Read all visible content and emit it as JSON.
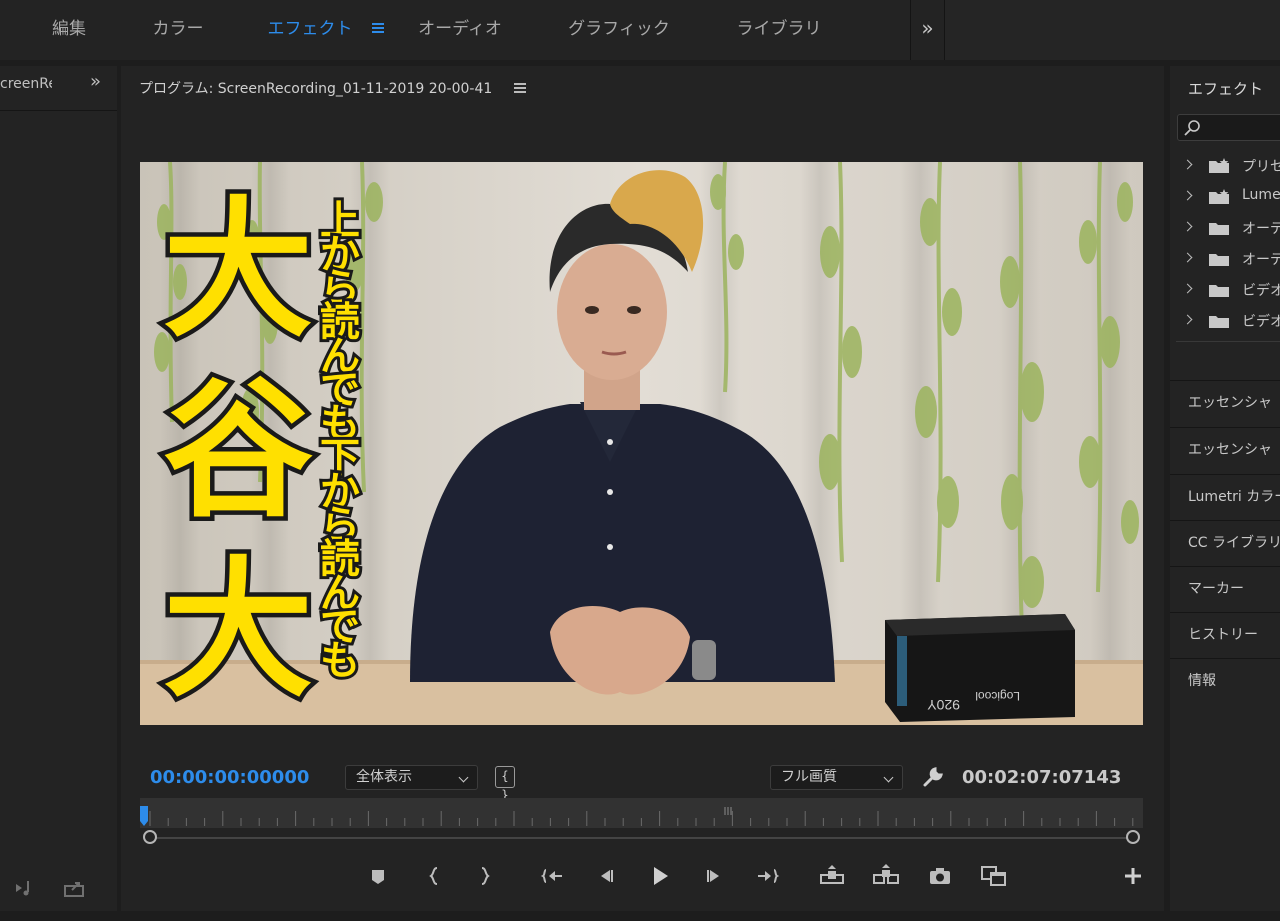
{
  "workspace_tabs": [
    {
      "label": "編集"
    },
    {
      "label": "カラー"
    },
    {
      "label": "エフェクト"
    },
    {
      "label": "オーディオ"
    },
    {
      "label": "グラフィック"
    },
    {
      "label": "ライブラリ"
    }
  ],
  "workspace_active": "エフェクト",
  "left_panel": {
    "tab_label": "creenRec"
  },
  "program_monitor": {
    "title": "プログラム: ScreenRecording_01-11-2019 20-00-41",
    "video_overlay": {
      "big_text": [
        "大",
        "谷",
        "大"
      ],
      "sub_text": "上から読んでも下から読んでも",
      "box_brand": "Logicool",
      "box_model": "920Y"
    },
    "current_timecode": "00:00:00:00000",
    "fit_dropdown": "全体表示",
    "quality_dropdown": "フル画質",
    "duration_timecode": "00:02:07:07143"
  },
  "effects_panel": {
    "title": "エフェクト",
    "tree_items": [
      {
        "label": "プリセ",
        "icon": "preset-folder-icon"
      },
      {
        "label": "Lumetri",
        "icon": "preset-folder-icon"
      },
      {
        "label": "オーディ",
        "icon": "folder-icon"
      },
      {
        "label": "オーディ",
        "icon": "folder-icon"
      },
      {
        "label": "ビデオ",
        "icon": "folder-icon"
      },
      {
        "label": "ビデオ",
        "icon": "folder-icon"
      }
    ],
    "sub_panels": [
      {
        "label": "エッセンシャ"
      },
      {
        "label": "エッセンシャ"
      },
      {
        "label": "Lumetri カラー"
      },
      {
        "label": "CC ライブラリ"
      },
      {
        "label": "マーカー"
      },
      {
        "label": "ヒストリー"
      },
      {
        "label": "情報"
      }
    ]
  },
  "colors": {
    "accent": "#2d8ceb",
    "panel_bg": "#232323",
    "title_yellow": "#ffe000"
  }
}
